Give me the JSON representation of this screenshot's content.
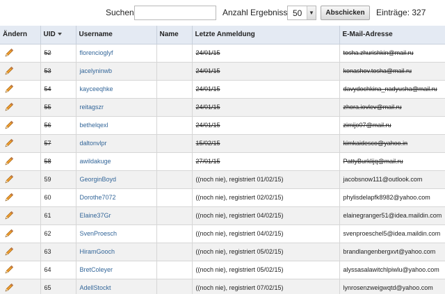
{
  "toolbar": {
    "search_label": "Suchen:",
    "search_value": "",
    "results_label": "Anzahl Ergebnisse:",
    "results_value": "50",
    "submit_label": "Abschicken",
    "entries_text": "Einträge: 327"
  },
  "table": {
    "columns": {
      "edit": "Ändern",
      "uid": "UID",
      "username": "Username",
      "name": "Name",
      "last_login": "Letzte Anmeldung",
      "email": "E-Mail-Adresse"
    },
    "rows": [
      {
        "uid": "52",
        "username": "florencioglyf",
        "name": "",
        "last_login": "24/01/15",
        "email": "tosha.zhurishkin@mail.ru",
        "disabled": true
      },
      {
        "uid": "53",
        "username": "jacelyninwb",
        "name": "",
        "last_login": "24/01/15",
        "email": "konashov.tosha@mail.ru",
        "disabled": true
      },
      {
        "uid": "54",
        "username": "kayceeqhke",
        "name": "",
        "last_login": "24/01/15",
        "email": "davydochkina_nadyusha@mail.ru",
        "disabled": true
      },
      {
        "uid": "55",
        "username": "reitagszr",
        "name": "",
        "last_login": "24/01/15",
        "email": "zhora.iovlev@mail.ru",
        "disabled": true
      },
      {
        "uid": "56",
        "username": "bethelqexl",
        "name": "",
        "last_login": "24/01/15",
        "email": "zimijo07@mail.ru",
        "disabled": true
      },
      {
        "uid": "57",
        "username": "daltonvlpr",
        "name": "",
        "last_login": "15/02/15",
        "email": "kimkaidesco@yahoo.in",
        "disabled": true
      },
      {
        "uid": "58",
        "username": "awildakuge",
        "name": "",
        "last_login": "27/01/15",
        "email": "PattyBurklijq@mail.ru",
        "disabled": true
      },
      {
        "uid": "59",
        "username": "GeorginBoyd",
        "name": "",
        "last_login": "((noch nie), registriert 01/02/15)",
        "email": "jacobsnow111@outlook.com",
        "disabled": false
      },
      {
        "uid": "60",
        "username": "Dorothe7072",
        "name": "",
        "last_login": "((noch nie), registriert 02/02/15)",
        "email": "phylisdelapfk8982@yahoo.com",
        "disabled": false
      },
      {
        "uid": "61",
        "username": "Elaine37Gr",
        "name": "",
        "last_login": "((noch nie), registriert 04/02/15)",
        "email": "elainegranger51@idea.maildin.com",
        "disabled": false
      },
      {
        "uid": "62",
        "username": "SvenProesch",
        "name": "",
        "last_login": "((noch nie), registriert 04/02/15)",
        "email": "svenproeschel5@idea.maildin.com",
        "disabled": false
      },
      {
        "uid": "63",
        "username": "HiramGooch",
        "name": "",
        "last_login": "((noch nie), registriert 05/02/15)",
        "email": "brandlangenbergxvt@yahoo.com",
        "disabled": false
      },
      {
        "uid": "64",
        "username": "BretColeyer",
        "name": "",
        "last_login": "((noch nie), registriert 05/02/15)",
        "email": "alyssasalawitchlpiwlu@yahoo.com",
        "disabled": false
      },
      {
        "uid": "65",
        "username": "AdellStockt",
        "name": "",
        "last_login": "((noch nie), registriert 07/02/15)",
        "email": "lynrosenzweigwqtd@yahoo.com",
        "disabled": false
      }
    ]
  },
  "icons": {
    "edit": "pencil-icon",
    "sort": "sort-desc-icon",
    "select": "chevron-down-icon"
  }
}
